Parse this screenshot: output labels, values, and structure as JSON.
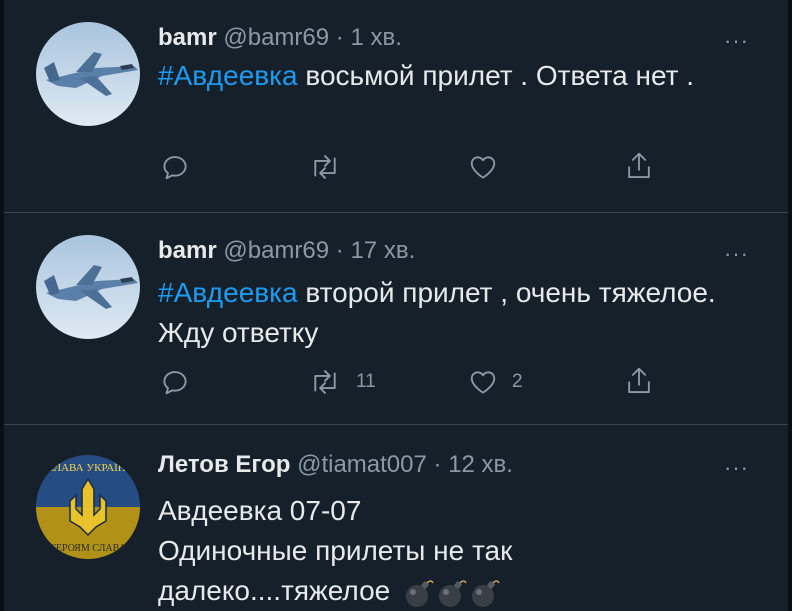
{
  "tweets": [
    {
      "name": "bamr",
      "handle": "@bamr69",
      "sep": "·",
      "time": "1 хв.",
      "more": "···",
      "hashtag": "#Авдеевка",
      "text": " восьмой прилет . Ответа нет .",
      "replies": "",
      "retweets": "",
      "likes": ""
    },
    {
      "name": "bamr",
      "handle": "@bamr69",
      "sep": "·",
      "time": "17 хв.",
      "more": "···",
      "hashtag": "#Авдеевка",
      "text": " второй прилет , очень тяжелое.  Жду ответку",
      "replies": "",
      "retweets": "11",
      "likes": "2"
    },
    {
      "name": "Летов Егор",
      "handle": "@tiamat007",
      "sep": "·",
      "time": "12 хв.",
      "more": "···",
      "line1": "Авдеевка 07-07",
      "line2": "Одиночные прилеты не так",
      "line3": "далеко....тяжелое",
      "avatar_top_text": "СЛАВА УКРАЇНІ",
      "avatar_bottom_text": "ГЕРОЯМ СЛАВА"
    }
  ],
  "colors": {
    "background": "#15202b",
    "accent": "#1d9bf0",
    "muted": "#8b98a5",
    "divider": "#38444d"
  },
  "icons": [
    "reply-icon",
    "retweet-icon",
    "like-icon",
    "share-icon",
    "more-icon",
    "bomb-icon"
  ]
}
